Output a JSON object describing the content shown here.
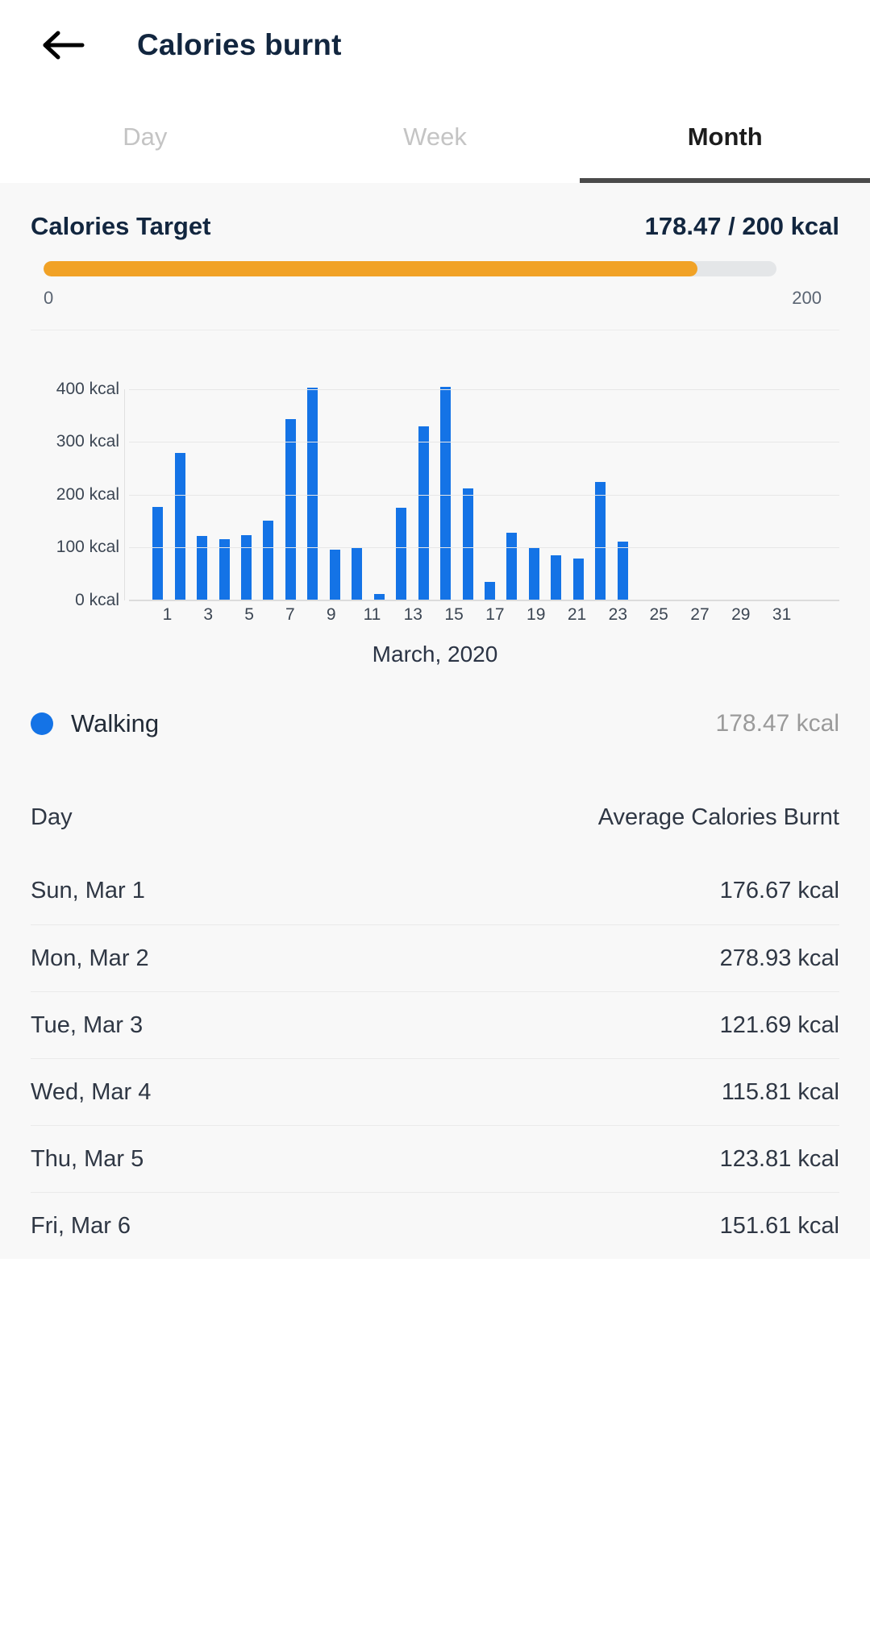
{
  "appbar": {
    "back_icon": "arrow-left-icon",
    "title": "Calories burnt"
  },
  "tabs": [
    {
      "label": "Day",
      "active": false
    },
    {
      "label": "Week",
      "active": false
    },
    {
      "label": "Month",
      "active": true
    }
  ],
  "target": {
    "label": "Calories Target",
    "value_text": "178.47 / 200 kcal",
    "current": 178.47,
    "goal": 200,
    "percent": 89.2,
    "scale_min": "0",
    "scale_max": "200",
    "fill_color": "#f1a226",
    "track_color": "#e4e6e8"
  },
  "chart_data": {
    "type": "bar",
    "title": "March, 2020",
    "xlabel": "",
    "ylabel": "",
    "ylim": [
      0,
      450
    ],
    "grid": true,
    "bar_color": "#1473e6",
    "y_ticks": [
      0,
      100,
      200,
      300,
      400
    ],
    "y_tick_labels": [
      "0 kcal",
      "100 kcal",
      "200 kcal",
      "300 kcal",
      "400 kcal"
    ],
    "x_tick_labels": [
      "1",
      "3",
      "5",
      "7",
      "9",
      "11",
      "13",
      "15",
      "17",
      "19",
      "21",
      "23",
      "25",
      "27",
      "29",
      "31"
    ],
    "categories": [
      "1",
      "2",
      "3",
      "4",
      "5",
      "6",
      "7",
      "8",
      "9",
      "10",
      "11",
      "12",
      "13",
      "14",
      "15",
      "16",
      "17",
      "18",
      "19",
      "20",
      "21",
      "22",
      "23",
      "24",
      "25",
      "26",
      "27",
      "28",
      "29",
      "30",
      "31"
    ],
    "values": [
      176.67,
      278.93,
      121.69,
      115.81,
      123.81,
      151.61,
      344,
      402,
      96,
      99,
      12,
      175,
      329,
      404,
      212,
      35,
      128,
      101,
      85,
      80,
      224,
      111,
      0,
      0,
      0,
      0,
      0,
      0,
      0,
      0,
      0
    ],
    "series": [
      {
        "name": "Walking",
        "values": [
          176.67,
          278.93,
          121.69,
          115.81,
          123.81,
          151.61,
          344,
          402,
          96,
          99,
          12,
          175,
          329,
          404,
          212,
          35,
          128,
          101,
          85,
          80,
          224,
          111,
          0,
          0,
          0,
          0,
          0,
          0,
          0,
          0,
          0
        ]
      }
    ],
    "legend_position": "below"
  },
  "legend": {
    "name": "Walking",
    "value": "178.47 kcal",
    "dot_color": "#1473e6"
  },
  "table": {
    "headers": [
      "Day",
      "Average Calories Burnt"
    ],
    "rows": [
      {
        "day": "Sun, Mar 1",
        "value": "176.67 kcal"
      },
      {
        "day": "Mon, Mar 2",
        "value": "278.93 kcal"
      },
      {
        "day": "Tue, Mar 3",
        "value": "121.69 kcal"
      },
      {
        "day": "Wed, Mar 4",
        "value": "115.81 kcal"
      },
      {
        "day": "Thu, Mar 5",
        "value": "123.81 kcal"
      },
      {
        "day": "Fri, Mar 6",
        "value": "151.61 kcal"
      }
    ]
  }
}
